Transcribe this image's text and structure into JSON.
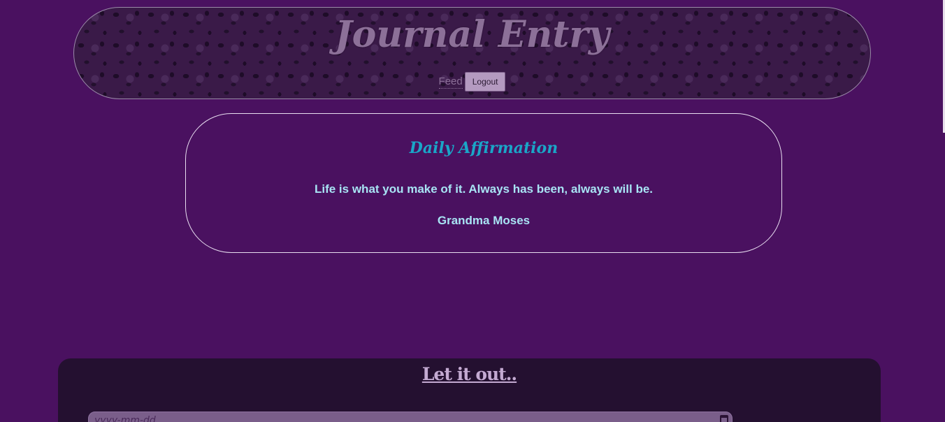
{
  "header": {
    "title": "Journal Entry",
    "nav_feed": "Feed",
    "logout_label": "Logout"
  },
  "affirmation": {
    "title": "Daily Affirmation",
    "quote": "Life is what you make of it. Always has been, always will be.",
    "author": "Grandma Moses"
  },
  "entry": {
    "title": "Let it out..",
    "date_placeholder": "yyyy-mm-dd"
  },
  "icons": {
    "calendar": "calendar-icon"
  },
  "colors": {
    "background": "#4a1160",
    "accent_title": "#1aa6c8",
    "quote_text": "#a8e4f4",
    "header_text": "#8c7098"
  }
}
